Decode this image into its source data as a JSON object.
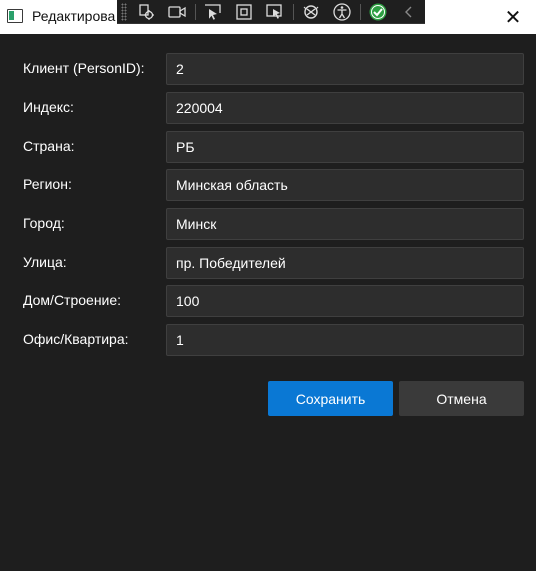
{
  "window": {
    "title": "Редактирова",
    "close_glyph": "✕"
  },
  "debug_toolbar": {
    "items": [
      "select-element-icon",
      "record-icon",
      "track-focus-icon",
      "display-layout-adorners-icon",
      "preview-selection-icon",
      "hot-reload-icon",
      "accessibility-icon",
      "binding-check-icon",
      "collapse-chevron-icon"
    ]
  },
  "form": {
    "fields": [
      {
        "label": "Клиент (PersonID):",
        "value": "2"
      },
      {
        "label": "Индекс:",
        "value": "220004"
      },
      {
        "label": "Страна:",
        "value": "РБ"
      },
      {
        "label": "Регион:",
        "value": "Минская область"
      },
      {
        "label": "Город:",
        "value": "Минск"
      },
      {
        "label": "Улица:",
        "value": "пр. Победителей"
      },
      {
        "label": "Дом/Строение:",
        "value": "100"
      },
      {
        "label": "Офис/Квартира:",
        "value": "1"
      }
    ]
  },
  "buttons": {
    "save_label": "Сохранить",
    "cancel_label": "Отмена"
  },
  "colors": {
    "background": "#1e1e1e",
    "field_background": "#2d2d2d",
    "primary_button": "#0a78d4",
    "secondary_button": "#3a3a3a"
  }
}
